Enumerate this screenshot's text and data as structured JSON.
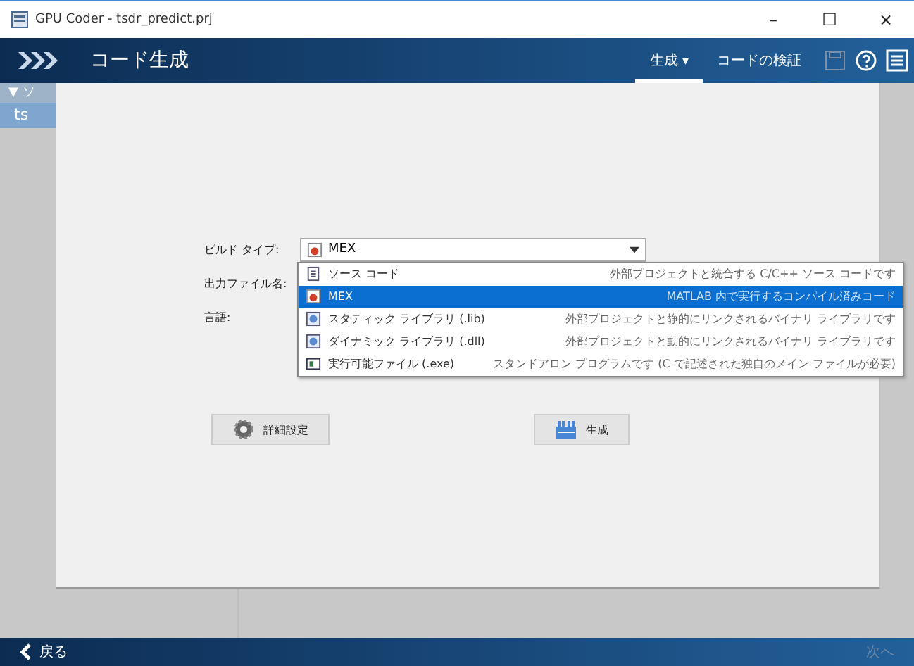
{
  "window": {
    "title": "GPU Coder - tsdr_predict.prj",
    "controls": [
      "–",
      "☐",
      "×"
    ]
  },
  "header": {
    "title": "コード生成",
    "menus": [
      {
        "label": "生成",
        "caret": "▾",
        "selected": true
      },
      {
        "label": "コードの検証",
        "selected": false
      }
    ]
  },
  "sidebar": {
    "heading": "▼ ソ",
    "items": [
      {
        "label": "ts",
        "selected": true
      }
    ]
  },
  "form": {
    "fields": [
      {
        "label": "ビルド タイプ:",
        "kind": "combo",
        "value": "MEX"
      },
      {
        "label": "出力ファイル名:",
        "kind": "text"
      },
      {
        "label": "言語:",
        "kind": "text"
      }
    ],
    "dropdown_options": [
      {
        "label": "ソース コード",
        "description": "外部プロジェクトと統合する C/C++ ソース コードです",
        "kind": "source",
        "selected": false
      },
      {
        "label": "MEX",
        "description": "MATLAB 内で実行するコンパイル済みコード",
        "kind": "mex",
        "selected": true
      },
      {
        "label": "スタティック ライブラリ (.lib)",
        "description": "外部プロジェクトと静的にリンクされるバイナリ ライブラリです",
        "kind": "lib",
        "selected": false
      },
      {
        "label": "ダイナミック ライブラリ (.dll)",
        "description": "外部プロジェクトと動的にリンクされるバイナリ ライブラリです",
        "kind": "lib",
        "selected": false
      },
      {
        "label": "実行可能ファイル (.exe)",
        "description": "スタンドアロン プログラムです (C で記述された独自のメイン ファイルが必要)",
        "kind": "exe",
        "selected": false
      }
    ],
    "buttons": [
      {
        "label": "詳細設定",
        "kind": "settings"
      },
      {
        "label": "生成",
        "kind": "build"
      }
    ]
  },
  "footer": {
    "back": "戻る",
    "next": {
      "label": "次へ",
      "disabled": true
    }
  }
}
